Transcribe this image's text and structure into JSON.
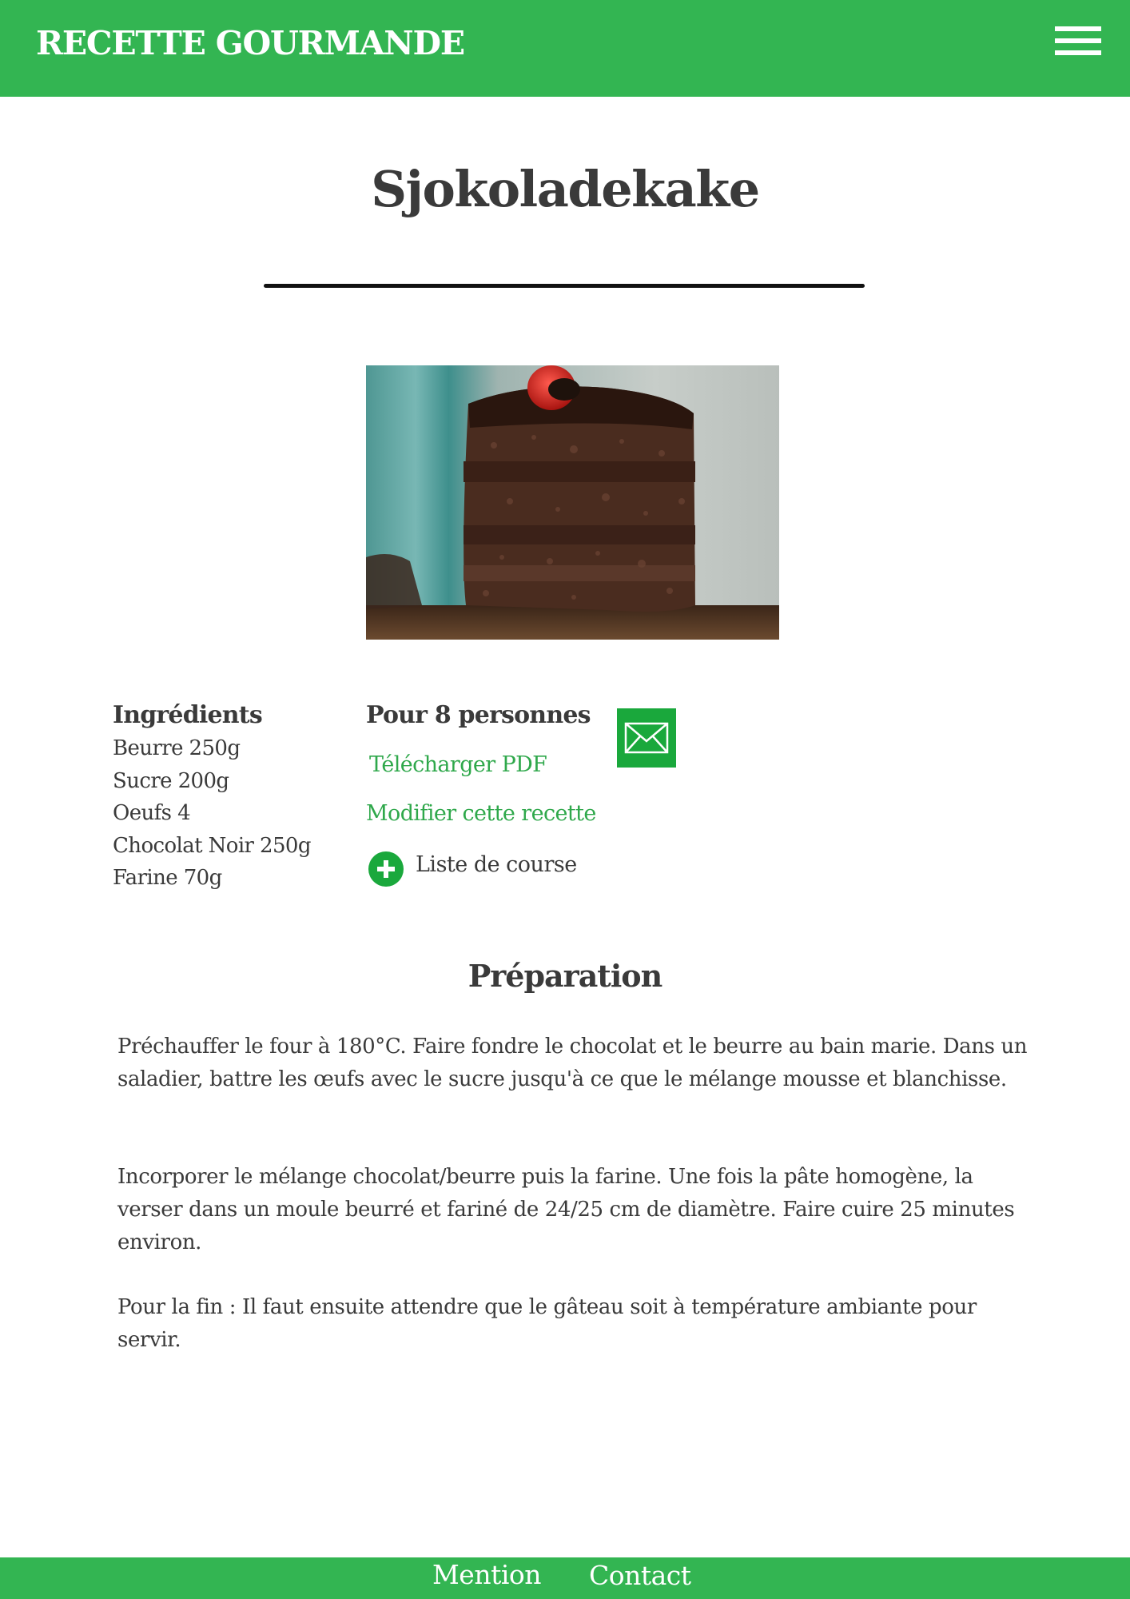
{
  "header": {
    "brand": "RECETTE GOURMANDE",
    "menu_icon": "hamburger-menu-icon",
    "background_color": "#33b552"
  },
  "recipe": {
    "title": "Sjokoladekake",
    "image": "chocolate-cake-slice-photo"
  },
  "ingredients": {
    "heading": "Ingrédients",
    "items": [
      "Beurre 250g",
      "Sucre 200g",
      "Oeufs 4",
      "Chocolat Noir 250g",
      "Farine 70g"
    ]
  },
  "actions": {
    "servings": "Pour 8 personnes",
    "download_pdf": "Télécharger  PDF",
    "edit_recipe": "Modifier cette recette",
    "shopping_list": "Liste de course",
    "mail_icon": "envelope-icon",
    "add_icon": "plus-circle-icon",
    "accent_color": "#2fa84b"
  },
  "preparation": {
    "heading": "Préparation",
    "paragraphs": [
      "Préchauffer le four à 180°C. Faire fondre le chocolat et le beurre au bain marie. Dans un saladier, battre les œufs avec le sucre jusqu'à ce que le mélange mousse et blanchisse.",
      "Incorporer le mélange chocolat/beurre puis la farine. Une fois la pâte homogène, la verser dans un moule beurré et fariné de 24/25 cm de diamètre. Faire cuire 25 minutes environ.",
      "Pour la fin : Il faut ensuite attendre que le gâteau soit à température ambiante pour servir."
    ]
  },
  "footer": {
    "links": [
      "Mention",
      "Contact"
    ]
  }
}
